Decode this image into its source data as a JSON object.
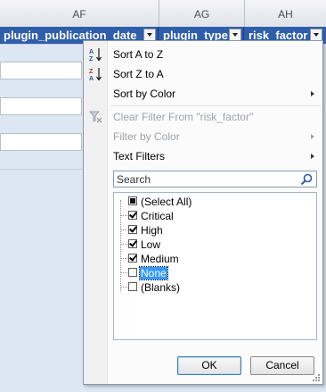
{
  "column_letters": [
    "AF",
    "AG",
    "AH"
  ],
  "fields": [
    {
      "name": "plugin_publication_date"
    },
    {
      "name": "plugin_type"
    },
    {
      "name": "risk_factor"
    }
  ],
  "menu": {
    "sort_asc": {
      "label": "Sort A to Z",
      "icon": "sort-a-to-z-icon"
    },
    "sort_desc": {
      "label": "Sort Z to A",
      "icon": "sort-z-to-a-icon"
    },
    "sort_color": {
      "label": "Sort by Color",
      "has_submenu": true
    },
    "clear_filter": {
      "label": "Clear Filter From \"risk_factor\"",
      "enabled": false,
      "icon": "clear-filter-icon"
    },
    "filter_color": {
      "label": "Filter by Color",
      "enabled": false,
      "has_submenu": true
    },
    "text_filters": {
      "label": "Text Filters",
      "has_submenu": true
    }
  },
  "search": {
    "placeholder": "Search"
  },
  "values": [
    {
      "label": "(Select All)",
      "state": "partial"
    },
    {
      "label": "Critical",
      "state": "checked"
    },
    {
      "label": "High",
      "state": "checked"
    },
    {
      "label": "Low",
      "state": "checked"
    },
    {
      "label": "Medium",
      "state": "checked"
    },
    {
      "label": "None",
      "state": "unchecked",
      "highlighted": true
    },
    {
      "label": "(Blanks)",
      "state": "unchecked"
    }
  ],
  "buttons": {
    "ok": "OK",
    "cancel": "Cancel"
  },
  "colors": {
    "header_blue": "#2f5eab",
    "selection": "#3399ff",
    "sheet_band": "#dde6f3"
  }
}
